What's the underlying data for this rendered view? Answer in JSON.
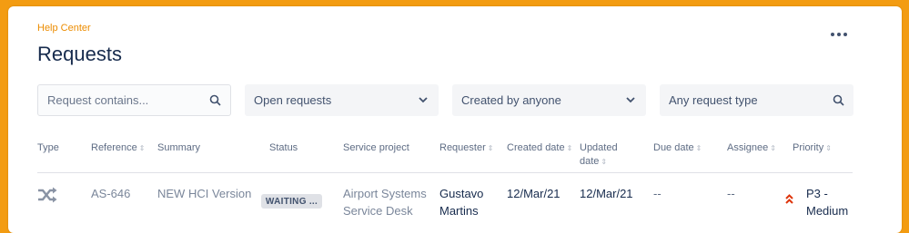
{
  "breadcrumb": "Help Center",
  "page_title": "Requests",
  "filters": {
    "search_placeholder": "Request contains...",
    "status": "Open requests",
    "created_by": "Created by anyone",
    "request_type": "Any request type"
  },
  "columns": {
    "type": "Type",
    "reference": "Reference",
    "summary": "Summary",
    "status": "Status",
    "service_project": "Service project",
    "requester": "Requester",
    "created_date": "Created date",
    "updated_date_1": "Updated",
    "updated_date_2": "date",
    "due_date": "Due date",
    "assignee": "Assignee",
    "priority": "Priority"
  },
  "rows": [
    {
      "type_icon": "shuffle-icon",
      "reference": "AS-646",
      "summary": "NEW HCI Version",
      "status": "WAITING ...",
      "service_project_1": "Airport Systems",
      "service_project_2": "Service Desk",
      "requester_1": "Gustavo",
      "requester_2": "Martins",
      "created_date": "12/Mar/21",
      "updated_date": "12/Mar/21",
      "due_date": "--",
      "assignee": "--",
      "priority_1": "P3 -",
      "priority_2": "Medium"
    }
  ],
  "colors": {
    "background": "#f39c12",
    "accent": "#ec8c00",
    "priority": "#de350b"
  }
}
